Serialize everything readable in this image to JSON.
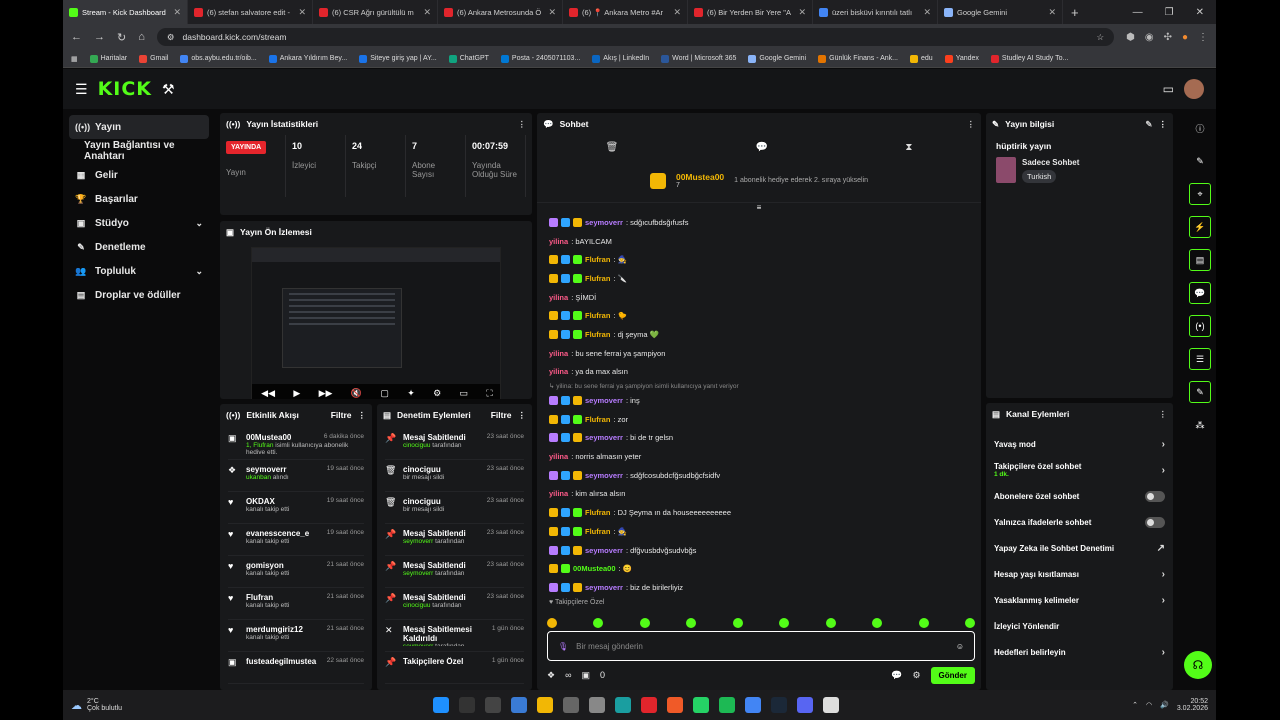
{
  "browser": {
    "tabs": [
      {
        "title": "Stream - Kick Dashboard",
        "color": "#53fc18",
        "active": true
      },
      {
        "title": "(6) stefan salvatore edit -",
        "color": "#e1252c"
      },
      {
        "title": "(6) CSR Ağrı gürültülü m",
        "color": "#e1252c"
      },
      {
        "title": "(6) Ankara Metrosunda Ö",
        "color": "#e1252c"
      },
      {
        "title": "(6) 📍 Ankara Metro #Ar",
        "color": "#e1252c"
      },
      {
        "title": "(6) Bir Yerden Bir Yere \"A",
        "color": "#e1252c"
      },
      {
        "title": "üzeri bisküvi kırıntılı tatlı",
        "color": "#4285f4"
      },
      {
        "title": "Google Gemini",
        "color": "#8ab4f8"
      }
    ],
    "url": "dashboard.kick.com/stream",
    "bookmarks": [
      "Haritalar",
      "Gmail",
      "obs.aybu.edu.tr/oib...",
      "Ankara Yıldırım Bey...",
      "Siteye giriş yap | AY...",
      "ChatGPT",
      "Posta - 2405071103...",
      "Akış | LinkedIn",
      "Word | Microsoft 365",
      "Google Gemini",
      "Günlük Finans - Ank...",
      "edu",
      "Yandex",
      "Studley AI Study To..."
    ]
  },
  "sidebar": {
    "items": [
      {
        "label": "Yayın",
        "icon": "broadcast-icon",
        "glyph": "((•))",
        "active": true
      },
      {
        "label": "Yayın Bağlantısı ve Anahtarı",
        "icon": "",
        "glyph": ""
      },
      {
        "label": "Gelir",
        "icon": "chart-icon",
        "glyph": "▦"
      },
      {
        "label": "Başarılar",
        "icon": "trophy-icon",
        "glyph": "🏆"
      },
      {
        "label": "Stüdyo",
        "icon": "studio-icon",
        "glyph": "▣",
        "chevron": true
      },
      {
        "label": "Denetleme",
        "icon": "wrench-icon",
        "glyph": "✎"
      },
      {
        "label": "Topluluk",
        "icon": "people-icon",
        "glyph": "👥",
        "chevron": true
      },
      {
        "label": "Droplar ve ödüller",
        "icon": "gift-icon",
        "glyph": "▤"
      }
    ]
  },
  "stats": {
    "title": "Yayın İstatistikleri",
    "live_badge": "YAYINDA",
    "live_label": "Yayın",
    "cells": [
      {
        "value": "10",
        "label": "İzleyici"
      },
      {
        "value": "24",
        "label": "Takipçi"
      },
      {
        "value": "7",
        "label": "Abone Sayısı"
      },
      {
        "value": "00:07:59",
        "label": "Yayında Olduğu Süre"
      }
    ]
  },
  "preview": {
    "title": "Yayın Ön İzlemesi"
  },
  "activity": {
    "title": "Etkinlik Akışı",
    "filter": "Filtre",
    "items": [
      {
        "icon": "gift-icon",
        "glyph": "▣",
        "name": "00Mustea00",
        "time": "6 dakika önce",
        "hl": "1, Flufran",
        "rest": " isimli kullanıcıya abonelik hediye etti."
      },
      {
        "icon": "drop-icon",
        "glyph": "❖",
        "name": "seymoverr",
        "time": "19 saat önce",
        "hl": "ukanban",
        "rest": " alındı"
      },
      {
        "icon": "heart-icon",
        "glyph": "♥",
        "name": "OKDAX",
        "time": "19 saat önce",
        "hl": "",
        "rest": "kanalı takip etti"
      },
      {
        "icon": "heart-icon",
        "glyph": "♥",
        "name": "evanesscence_e",
        "time": "19 saat önce",
        "hl": "",
        "rest": "kanalı takip etti"
      },
      {
        "icon": "heart-icon",
        "glyph": "♥",
        "name": "gomisyon",
        "time": "21 saat önce",
        "hl": "",
        "rest": "kanalı takip etti"
      },
      {
        "icon": "heart-icon",
        "glyph": "♥",
        "name": "Flufran",
        "time": "21 saat önce",
        "hl": "",
        "rest": "kanalı takip etti"
      },
      {
        "icon": "heart-icon",
        "glyph": "♥",
        "name": "merdumgiriz12",
        "time": "21 saat önce",
        "hl": "",
        "rest": "kanalı takip etti"
      },
      {
        "icon": "gift-icon",
        "glyph": "▣",
        "name": "fusteadegilmustea",
        "time": "22 saat önce",
        "hl": "",
        "rest": ""
      }
    ]
  },
  "moderation": {
    "title": "Denetim Eylemleri",
    "filter": "Filtre",
    "items": [
      {
        "icon": "pin-icon",
        "glyph": "📌",
        "name": "Mesaj Sabitlendi",
        "time": "23 saat önce",
        "hl": "cinociguu",
        "rest": " tarafından"
      },
      {
        "icon": "trash-icon",
        "glyph": "🗑",
        "name": "cinociguu",
        "time": "23 saat önce",
        "hl": "",
        "rest": "bir mesajı sildi"
      },
      {
        "icon": "trash-icon",
        "glyph": "🗑",
        "name": "cinociguu",
        "time": "23 saat önce",
        "hl": "",
        "rest": "bir mesajı sildi"
      },
      {
        "icon": "pin-icon",
        "glyph": "📌",
        "name": "Mesaj Sabitlendi",
        "time": "23 saat önce",
        "hl": "seymoverr",
        "rest": " tarafından"
      },
      {
        "icon": "pin-icon",
        "glyph": "📌",
        "name": "Mesaj Sabitlendi",
        "time": "23 saat önce",
        "hl": "seymoverr",
        "rest": " tarafından"
      },
      {
        "icon": "pin-icon",
        "glyph": "📌",
        "name": "Mesaj Sabitlendi",
        "time": "23 saat önce",
        "hl": "cinociguu",
        "rest": " tarafından"
      },
      {
        "icon": "unpin-icon",
        "glyph": "✕",
        "name": "Mesaj Sabitlemesi Kaldırıldı",
        "time": "1 gün önce",
        "hl": "seymoverr",
        "rest": " tarafından"
      },
      {
        "icon": "pin-icon",
        "glyph": "📌",
        "name": "Takipçilere Özel",
        "time": "1 gün önce",
        "hl": "",
        "rest": ""
      }
    ]
  },
  "chat": {
    "title": "Sohbet",
    "pinned_user": "00Mustea00",
    "pinned_count": "7",
    "pinned_note": "1 abonelik hediye ederek 2. sıraya yükselin",
    "messages": [
      {
        "user": "seymoverr",
        "color": "#b77cff",
        "badges": [
          "#b77cff",
          "#2fa5ff",
          "#f2b705"
        ],
        "text": ": sdğıcufbdsğıfusfs"
      },
      {
        "user": "yilina",
        "color": "#ff5b8a",
        "badges": [],
        "text": ": bAYILCAM"
      },
      {
        "user": "Flufran",
        "color": "#f2b705",
        "badges": [
          "#f2b705",
          "#2fa5ff",
          "#53fc18"
        ],
        "text": ": 🧙"
      },
      {
        "user": "Flufran",
        "color": "#f2b705",
        "badges": [
          "#f2b705",
          "#2fa5ff",
          "#53fc18"
        ],
        "text": ": 🔪"
      },
      {
        "user": "yilina",
        "color": "#ff5b8a",
        "badges": [],
        "text": ": ŞİMDİ"
      },
      {
        "user": "Flufran",
        "color": "#f2b705",
        "badges": [
          "#f2b705",
          "#2fa5ff",
          "#53fc18"
        ],
        "text": ": 🐤"
      },
      {
        "user": "Flufran",
        "color": "#f2b705",
        "badges": [
          "#f2b705",
          "#2fa5ff",
          "#53fc18"
        ],
        "text": ": dj şeyma 💚"
      },
      {
        "user": "yilina",
        "color": "#ff5b8a",
        "badges": [],
        "text": ": bu sene ferrai ya şampiyon"
      },
      {
        "user": "yilina",
        "color": "#ff5b8a",
        "badges": [],
        "text": ": ya da max alsın"
      },
      {
        "user": "seymoverr",
        "color": "#b77cff",
        "badges": [
          "#b77cff",
          "#2fa5ff",
          "#f2b705"
        ],
        "text": ": inş",
        "reply": "↳ yilina: bu sene ferrai ya şampiyon isimli kullanıcıya yanıt veriyor"
      },
      {
        "user": "Flufran",
        "color": "#f2b705",
        "badges": [
          "#f2b705",
          "#2fa5ff",
          "#53fc18"
        ],
        "text": ": zor"
      },
      {
        "user": "seymoverr",
        "color": "#b77cff",
        "badges": [
          "#b77cff",
          "#2fa5ff",
          "#f2b705"
        ],
        "text": ": bi de tr gelsn"
      },
      {
        "user": "yilina",
        "color": "#ff5b8a",
        "badges": [],
        "text": ": norris almasın yeter"
      },
      {
        "user": "seymoverr",
        "color": "#b77cff",
        "badges": [
          "#b77cff",
          "#2fa5ff",
          "#f2b705"
        ],
        "text": ": sdğfcosubdcfğsudbğcfsidfv"
      },
      {
        "user": "yilina",
        "color": "#ff5b8a",
        "badges": [],
        "text": ": kim alırsa alsın"
      },
      {
        "user": "Flufran",
        "color": "#f2b705",
        "badges": [
          "#f2b705",
          "#2fa5ff",
          "#53fc18"
        ],
        "text": ": DJ Şeyma ın da houseeeeeeeeee"
      },
      {
        "user": "Flufran",
        "color": "#f2b705",
        "badges": [
          "#f2b705",
          "#2fa5ff",
          "#53fc18"
        ],
        "text": ": 🧙"
      },
      {
        "user": "seymoverr",
        "color": "#b77cff",
        "badges": [
          "#b77cff",
          "#2fa5ff",
          "#f2b705"
        ],
        "text": ": dfğvusbdvğsudvbğs"
      },
      {
        "user": "00Mustea00",
        "color": "#53fc18",
        "badges": [
          "#f2b705",
          "#53fc18"
        ],
        "text": ": 😊"
      },
      {
        "user": "seymoverr",
        "color": "#b77cff",
        "badges": [
          "#b77cff",
          "#2fa5ff",
          "#f2b705"
        ],
        "text": ": biz de birilerliyiz"
      }
    ],
    "followers_only": "Takipçilere Özel",
    "placeholder": "Bir mesaj gönderin",
    "followers_count": "∞",
    "subs_count": "0",
    "send_label": "Gönder"
  },
  "stream_info": {
    "title": "Yayın bilgisi",
    "stream_title": "hüptirik yayın",
    "category": "Sadece Sohbet",
    "tag": "Turkish"
  },
  "channel_actions": {
    "title": "Kanal Eylemleri",
    "items": [
      {
        "label": "Yavaş mod",
        "type": "chevron",
        "sub": ""
      },
      {
        "label": "Takipçilere özel sohbet",
        "type": "chevron",
        "sub": "1 dk."
      },
      {
        "label": "Abonelere özel sohbet",
        "type": "toggle",
        "sub": ""
      },
      {
        "label": "Yalnızca ifadelerle sohbet",
        "type": "toggle",
        "sub": ""
      },
      {
        "label": "Yapay Zeka ile Sohbet Denetimi",
        "type": "external",
        "sub": ""
      },
      {
        "label": "Hesap yaşı kısıtlaması",
        "type": "chevron",
        "sub": ""
      },
      {
        "label": "Yasaklanmış kelimeler",
        "type": "chevron",
        "sub": ""
      },
      {
        "label": "İzleyici Yönlendir",
        "type": "none",
        "sub": ""
      },
      {
        "label": "Hedefleri belirleyin",
        "type": "chevron",
        "sub": ""
      }
    ]
  },
  "taskbar": {
    "weather_temp": "2°C",
    "weather_text": "Çok bulutlu",
    "time": "20:52",
    "date": "3.02.2026"
  }
}
